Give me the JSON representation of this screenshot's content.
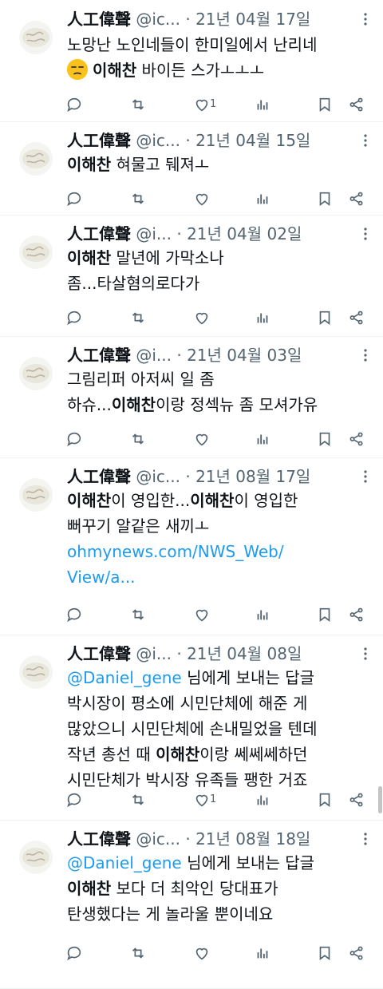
{
  "colors": {
    "text": "#0f1419",
    "muted": "#536471",
    "link": "#1d9bf0",
    "divider": "#eff3f4"
  },
  "tweets": [
    {
      "name": "人工偉聲",
      "handle": "@ic...",
      "date": "21년 04월 17일",
      "lines": [
        [
          {
            "t": "노망난 노인네들이 한미일에서 난리네"
          }
        ],
        [
          {
            "emoji": "unamused-face-emoji"
          },
          {
            "t": "이해찬",
            "b": true
          },
          {
            "t": " 바이든 스가ㅗㅗㅗ"
          }
        ]
      ],
      "likes": "1"
    },
    {
      "name": "人工偉聲",
      "handle": "@ic...",
      "date": "21년 04월 15일",
      "lines": [
        [
          {
            "t": "이해찬",
            "b": true
          },
          {
            "t": " 혀물고 뒈져ㅗ"
          }
        ]
      ],
      "likes": ""
    },
    {
      "name": "人工偉聲",
      "handle": "@i...",
      "date": "21년 04월 02일",
      "lines": [
        [
          {
            "t": "이해찬",
            "b": true
          },
          {
            "t": " 말년에 가막소나"
          }
        ],
        [
          {
            "t": "좀..."
          },
          {
            "t": "타살혐의로다가"
          }
        ]
      ],
      "likes": ""
    },
    {
      "name": "人工偉聲",
      "handle": "@i...",
      "date": "21년 04월 03일",
      "lines": [
        [
          {
            "t": "그림리퍼 아저씨 일 좀"
          }
        ],
        [
          {
            "t": "하슈..."
          },
          {
            "t": "이해찬",
            "b": true
          },
          {
            "t": "이랑 정섹뉴 좀 모셔가유"
          }
        ]
      ],
      "likes": ""
    },
    {
      "name": "人工偉聲",
      "handle": "@ic...",
      "date": "21년 08월 17일",
      "lines": [
        [
          {
            "t": "이해찬",
            "b": true
          },
          {
            "t": "이 영입한..."
          },
          {
            "t": "이해찬",
            "b": true
          },
          {
            "t": "이 영입한"
          }
        ],
        [
          {
            "t": "뻐꾸기 알같은 새끼ㅗ"
          }
        ],
        [
          {
            "t": "ohmynews.com/NWS_Web/",
            "link": true
          }
        ],
        [
          {
            "t": "View/a...",
            "link": true
          }
        ]
      ],
      "likes": ""
    },
    {
      "name": "人工偉聲",
      "handle": "@i...",
      "date": "21년 04월 08일",
      "lines": [
        [
          {
            "t": "@Daniel_gene",
            "link": true
          },
          {
            "t": " 님에게 보내는 답글"
          }
        ],
        [
          {
            "t": "박시장이 평소에 시민단체에 해준 게"
          }
        ],
        [
          {
            "t": "많았으니 시민단체에 손내밀었을 텐데"
          }
        ],
        [
          {
            "t": "작년 총선 때 "
          },
          {
            "t": "이해찬",
            "b": true
          },
          {
            "t": "이랑 쎄쎄쎄하던"
          }
        ],
        [
          {
            "t": "시민단체가 박시장 유족들 팽한 거죠"
          }
        ]
      ],
      "likes": "1"
    },
    {
      "name": "人工偉聲",
      "handle": "@ic...",
      "date": "21년 08월 18일",
      "lines": [
        [
          {
            "t": "@Daniel_gene",
            "link": true
          },
          {
            "t": " 님에게 보내는 답글"
          }
        ],
        [
          {
            "t": "이해찬",
            "b": true
          },
          {
            "t": " 보다 더 최악인 당대표가"
          }
        ],
        [
          {
            "t": "탄생했다는 게 놀라울 뿐이네요"
          }
        ]
      ],
      "likes": ""
    }
  ],
  "icons": {
    "actions": [
      "reply-icon",
      "retweet-icon",
      "like-icon",
      "views-icon",
      "bookmark-icon",
      "share-icon"
    ],
    "more": "more-icon",
    "avatar": "avatar"
  },
  "header_separator": "·"
}
